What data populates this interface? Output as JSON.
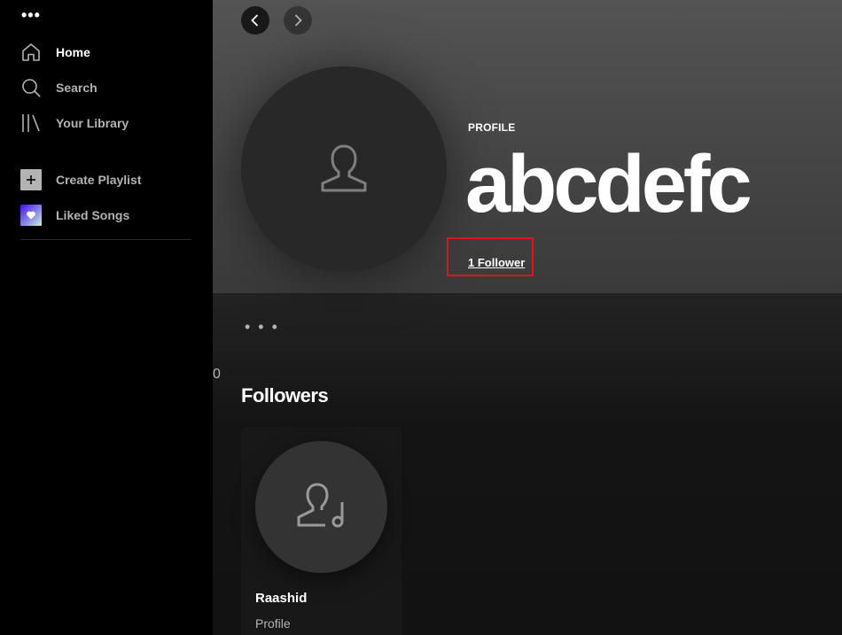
{
  "sidebar": {
    "menu_dots": "•••",
    "nav": [
      {
        "label": "Home",
        "icon": "home-icon"
      },
      {
        "label": "Search",
        "icon": "search-icon"
      },
      {
        "label": "Your Library",
        "icon": "library-icon"
      }
    ],
    "create_playlist": "Create Playlist",
    "liked_songs": "Liked Songs"
  },
  "profile": {
    "type_label": "PROFILE",
    "name": "abcdefc",
    "followers": "1 Follower",
    "more": "• • •"
  },
  "stray_text": "0",
  "followers_section": {
    "title": "Followers",
    "cards": [
      {
        "name": "Raashid",
        "subtitle": "Profile"
      }
    ]
  },
  "colors": {
    "sidebar_bg": "#000000",
    "main_bg": "#121212",
    "highlight_border": "#e0141e"
  }
}
